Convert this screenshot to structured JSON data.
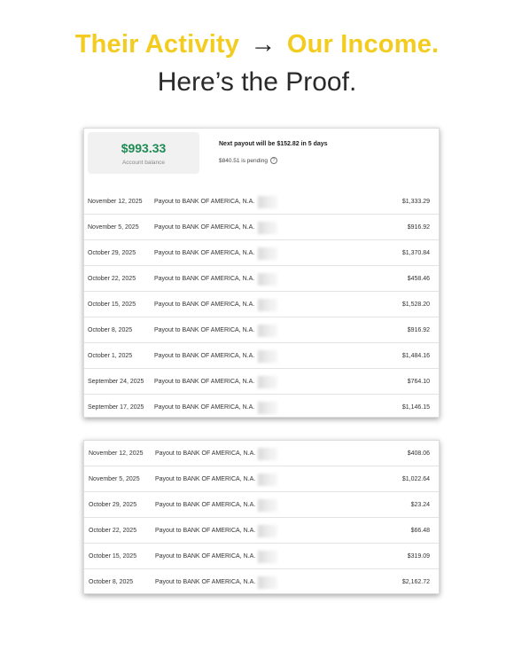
{
  "headline": {
    "part1": "Their Activity",
    "arrow": "→",
    "part2": "Our Income.",
    "line2": "Here’s the Proof."
  },
  "colors": {
    "accent": "#f3cc1f",
    "balance_green": "#1e8a54"
  },
  "summary": {
    "balance": "$993.33",
    "balance_label": "Account balance",
    "next_payout": "Next payout will be $152.82 in 5 days",
    "pending": "$840.51 is pending",
    "help_icon": "?"
  },
  "table1": [
    {
      "date": "November 12, 2025",
      "description": "Payout to BANK OF AMERICA, N.A.",
      "amount": "$1,333.29"
    },
    {
      "date": "November 5, 2025",
      "description": "Payout to BANK OF AMERICA, N.A.",
      "amount": "$916.92"
    },
    {
      "date": "October 29, 2025",
      "description": "Payout to BANK OF AMERICA, N.A.",
      "amount": "$1,370.84"
    },
    {
      "date": "October 22, 2025",
      "description": "Payout to BANK OF AMERICA, N.A.",
      "amount": "$458.46"
    },
    {
      "date": "October 15, 2025",
      "description": "Payout to BANK OF AMERICA, N.A.",
      "amount": "$1,528.20"
    },
    {
      "date": "October 8, 2025",
      "description": "Payout to BANK OF AMERICA, N.A.",
      "amount": "$916.92"
    },
    {
      "date": "October 1, 2025",
      "description": "Payout to BANK OF AMERICA, N.A.",
      "amount": "$1,484.16"
    },
    {
      "date": "September 24, 2025",
      "description": "Payout to BANK OF AMERICA, N.A.",
      "amount": "$764.10"
    },
    {
      "date": "September 17, 2025",
      "description": "Payout to BANK OF AMERICA, N.A.",
      "amount": "$1,146.15"
    }
  ],
  "table2": [
    {
      "date": "November 12, 2025",
      "description": "Payout to BANK OF AMERICA, N.A.",
      "amount": "$408.06"
    },
    {
      "date": "November 5, 2025",
      "description": "Payout to BANK OF AMERICA, N.A.",
      "amount": "$1,022.64"
    },
    {
      "date": "October 29, 2025",
      "description": "Payout to BANK OF AMERICA, N.A.",
      "amount": "$23.24"
    },
    {
      "date": "October 22, 2025",
      "description": "Payout to BANK OF AMERICA, N.A.",
      "amount": "$66.48"
    },
    {
      "date": "October 15, 2025",
      "description": "Payout to BANK OF AMERICA, N.A.",
      "amount": "$319.09"
    },
    {
      "date": "October 8, 2025",
      "description": "Payout to BANK OF AMERICA, N.A.",
      "amount": "$2,162.72"
    }
  ]
}
